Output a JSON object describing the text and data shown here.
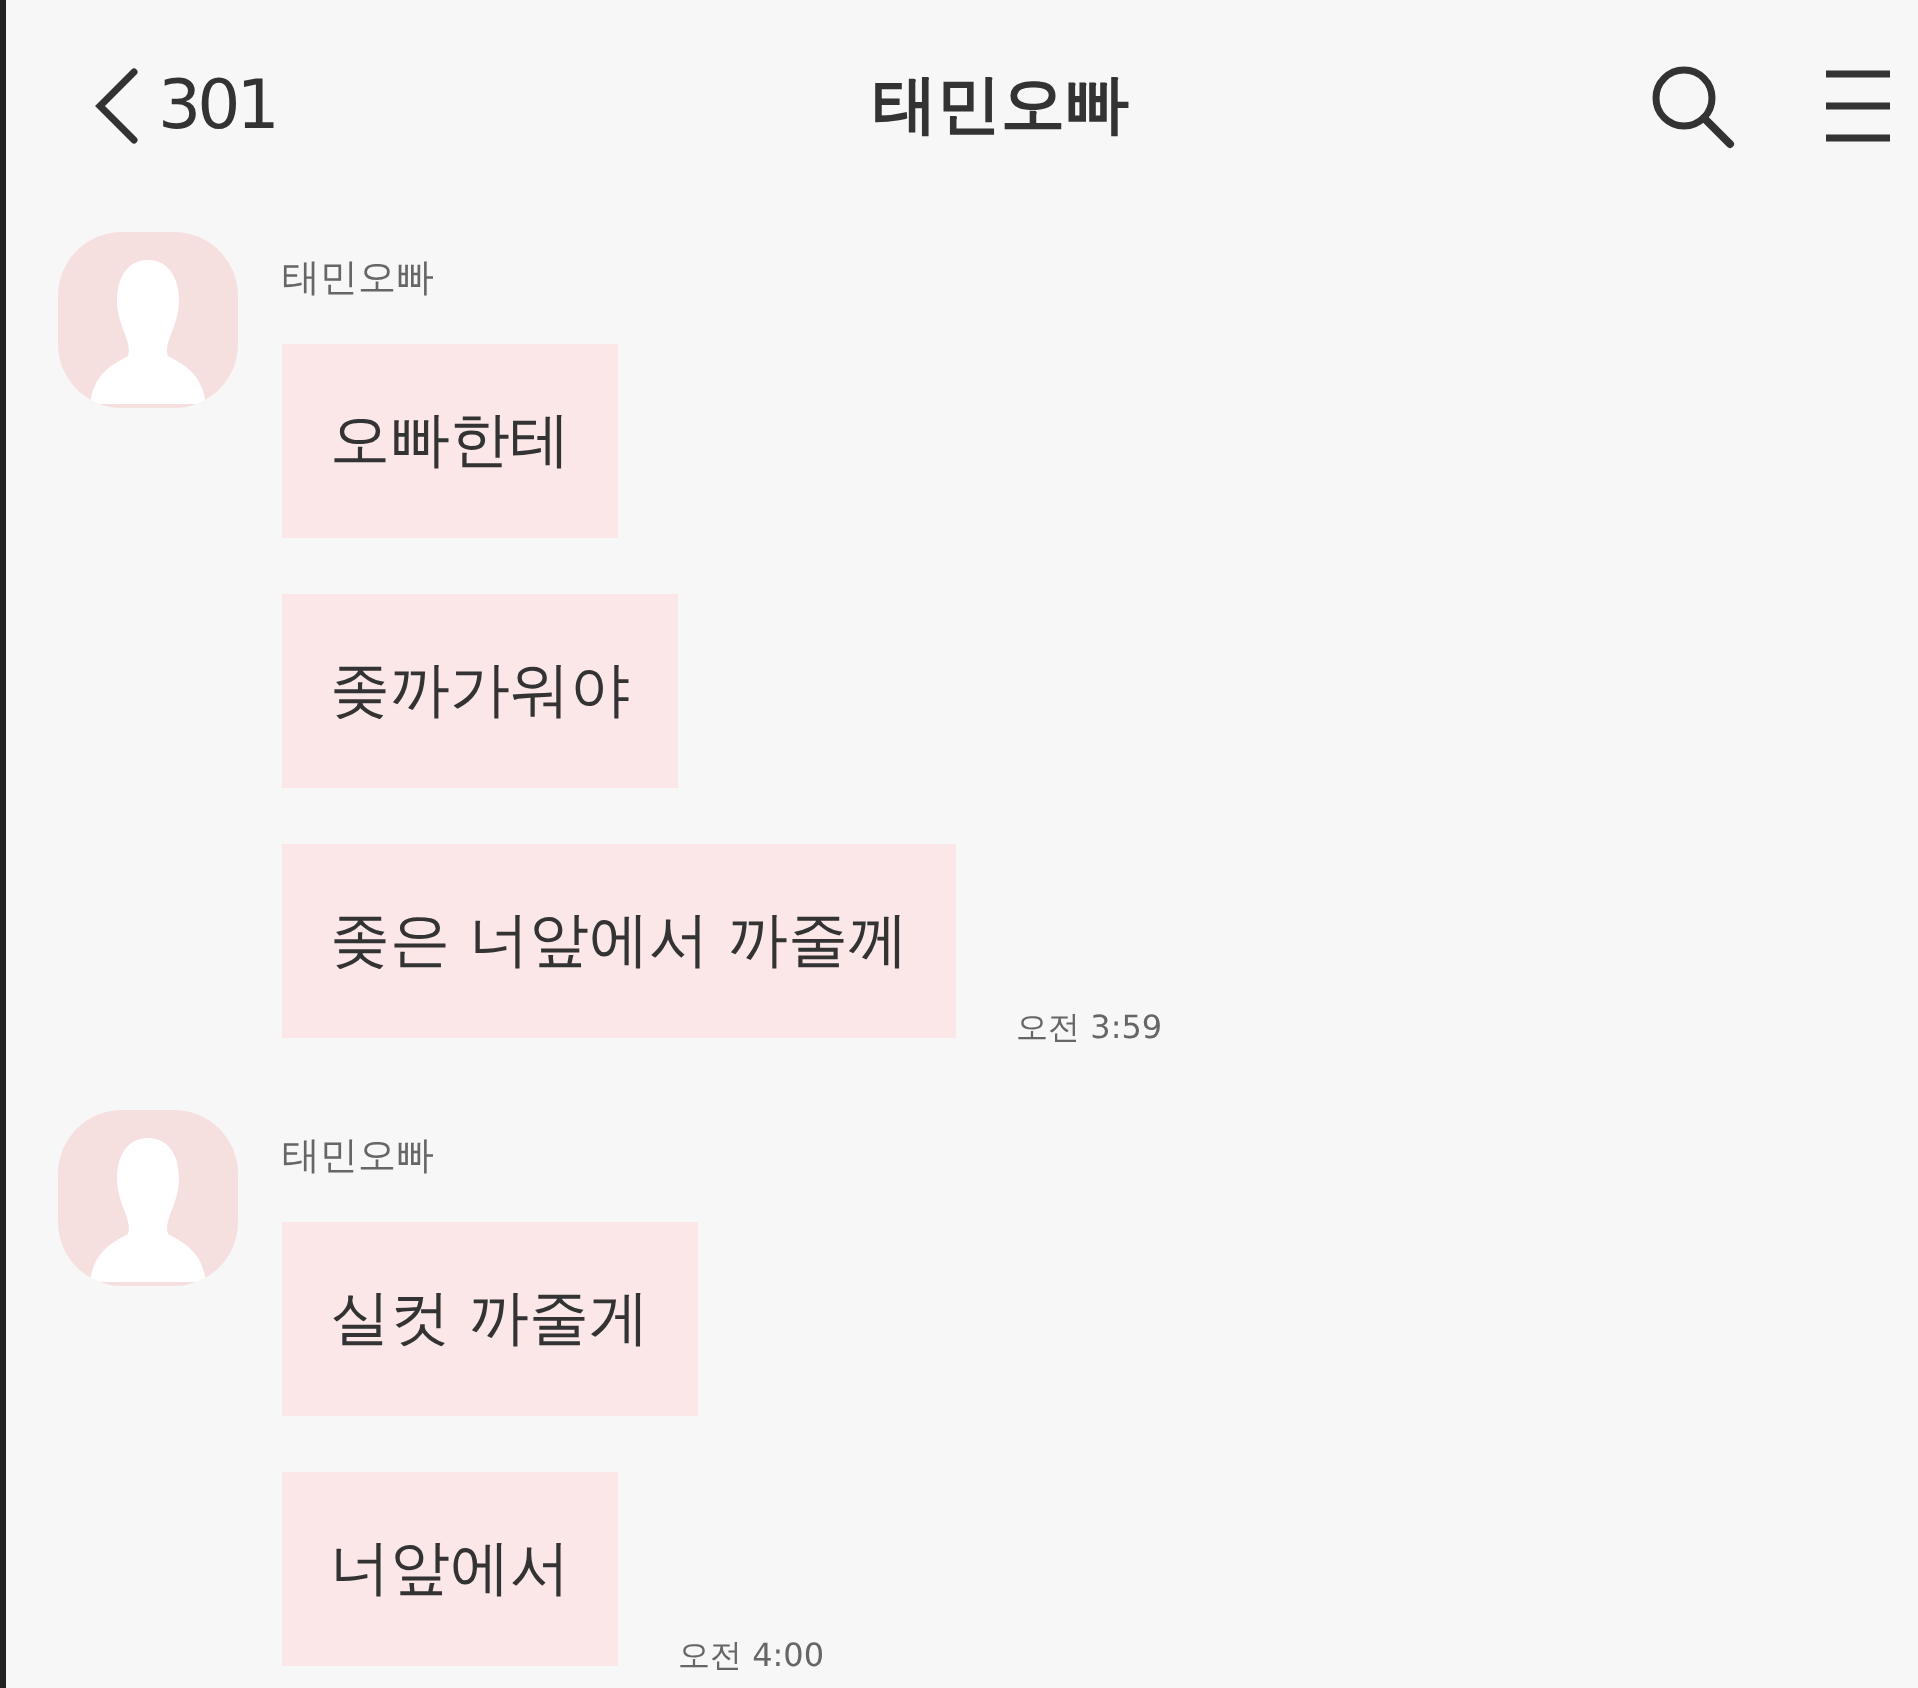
{
  "header": {
    "back_label": "301",
    "title": "태민오빠"
  },
  "message_groups": [
    {
      "sender": "태민오빠",
      "messages": [
        "오빠한테",
        "좆까가워야",
        "좆은 너앞에서 까줄께"
      ],
      "time": "오전 3:59"
    },
    {
      "sender": "태민오빠",
      "messages": [
        "실컷 까줄게",
        "너앞에서"
      ],
      "time": "오전 4:00"
    }
  ]
}
